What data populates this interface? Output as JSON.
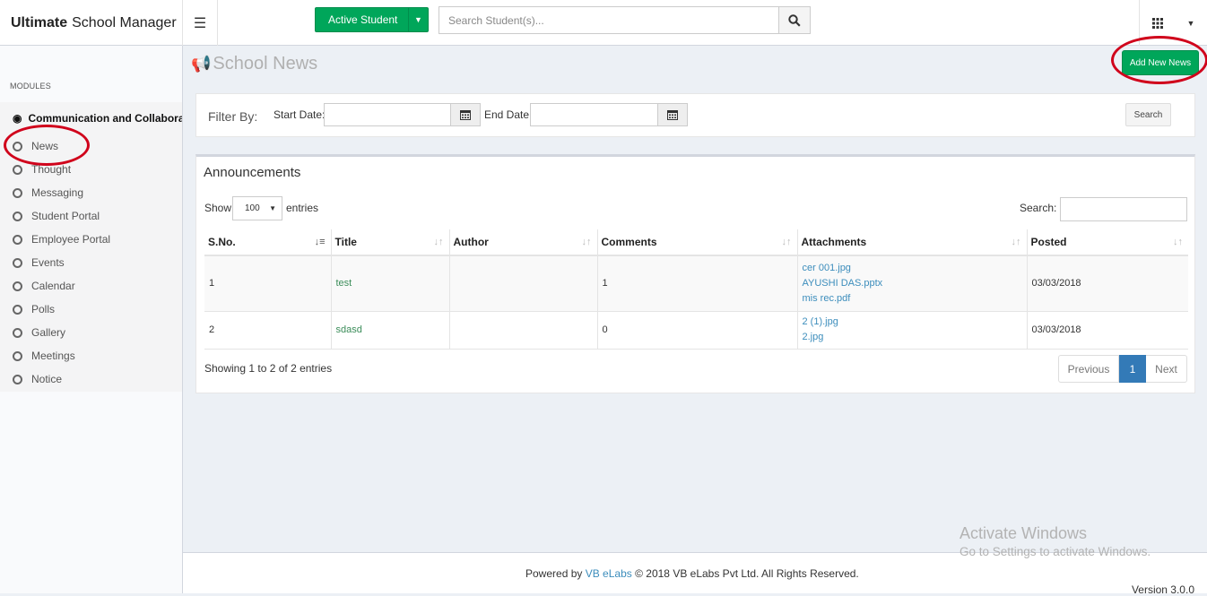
{
  "header": {
    "brand_bold": "Ultimate",
    "brand_rest": "School Manager",
    "active_student_label": "Active Student",
    "search_placeholder": "Search Student(s)..."
  },
  "sidebar": {
    "modules_label": "MODULES",
    "group_label": "Communication and Collaboration",
    "items": [
      {
        "label": "News"
      },
      {
        "label": "Thought"
      },
      {
        "label": "Messaging"
      },
      {
        "label": "Student Portal"
      },
      {
        "label": "Employee Portal"
      },
      {
        "label": "Events"
      },
      {
        "label": "Calendar"
      },
      {
        "label": "Polls"
      },
      {
        "label": "Gallery"
      },
      {
        "label": "Meetings"
      },
      {
        "label": "Notice"
      }
    ]
  },
  "page": {
    "title": "School News",
    "add_news_label": "Add New News"
  },
  "filter": {
    "label": "Filter By:",
    "start_date_label": "Start Date:",
    "end_date_label": "End Date:",
    "start_date_value": "",
    "end_date_value": "",
    "search_label": "Search"
  },
  "announcements": {
    "title": "Announcements",
    "show_label": "Show",
    "entries_value": "100",
    "entries_label": "entries",
    "search_label": "Search:",
    "search_value": "",
    "columns": [
      "S.No.",
      "Title",
      "Author",
      "Comments",
      "Attachments",
      "Posted"
    ],
    "rows": [
      {
        "sno": "1",
        "title": "test",
        "author": "",
        "comments": "1",
        "attachments": [
          "cer 001.jpg",
          "AYUSHI DAS.pptx",
          "mis rec.pdf"
        ],
        "posted": "03/03/2018"
      },
      {
        "sno": "2",
        "title": "sdasd",
        "author": "",
        "comments": "0",
        "attachments": [
          "2 (1).jpg",
          "2.jpg"
        ],
        "posted": "03/03/2018"
      }
    ],
    "showing_text": "Showing 1 to 2 of 2 entries",
    "pagination": {
      "previous": "Previous",
      "current": "1",
      "next": "Next"
    }
  },
  "footer": {
    "powered_by": "Powered by",
    "vb_link": "VB eLabs",
    "copyright": "© 2018 VB eLabs Pvt Ltd. All Rights Reserved.",
    "version": "Version 3.0.0"
  },
  "watermark": {
    "line1": "Activate Windows",
    "line2": "Go to Settings to activate Windows."
  },
  "colors": {
    "primary_green": "#00a65a",
    "link_blue": "#3c8dbc",
    "pagination_blue": "#337ab7",
    "annotation_red": "#d0021b"
  },
  "icons": {
    "hamburger": "bars-icon",
    "search": "search-icon",
    "apps": "grid-icon",
    "group": "dashboard-icon",
    "title": "bullhorn-icon",
    "calendar": "calendar-icon"
  }
}
